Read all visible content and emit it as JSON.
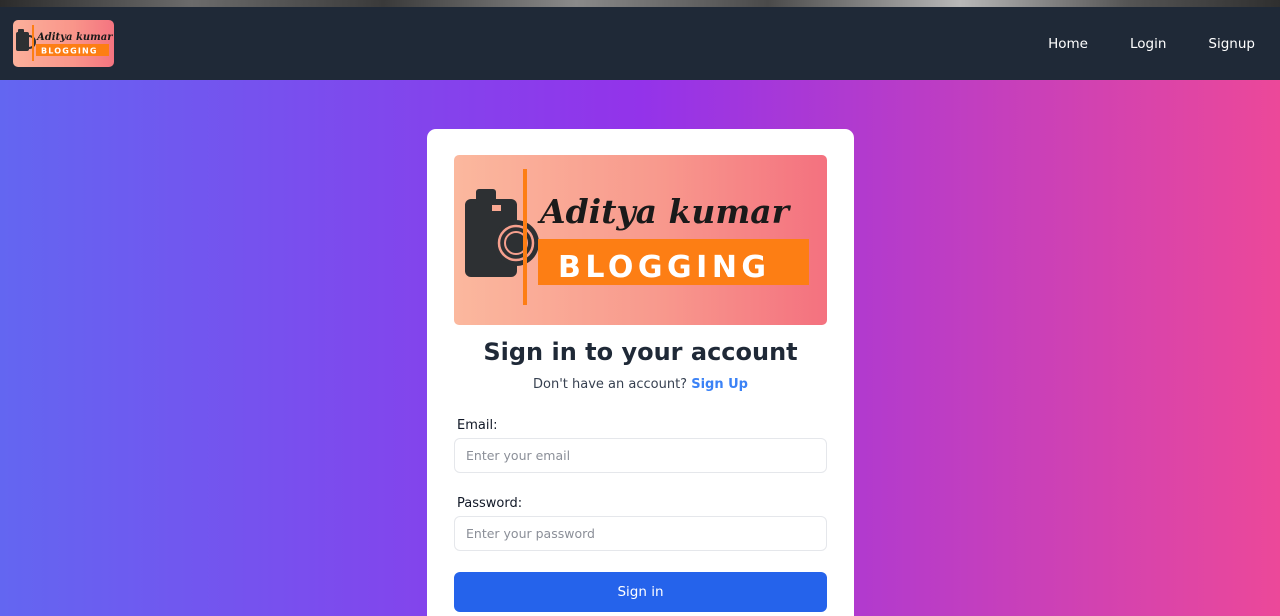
{
  "logo": {
    "line1": "Aditya kumar",
    "line2": "BLOGGING"
  },
  "nav": {
    "items": [
      {
        "label": "Home"
      },
      {
        "label": "Login"
      },
      {
        "label": "Signup"
      }
    ]
  },
  "login": {
    "title": "Sign in to your account",
    "prompt": "Don't have an account?",
    "signup_link": "Sign Up",
    "email_label": "Email:",
    "email_placeholder": "Enter your email",
    "password_label": "Password:",
    "password_placeholder": "Enter your password",
    "submit": "Sign in"
  },
  "colors": {
    "navbar": "#1f2937",
    "gradient_start": "#6366f1",
    "gradient_mid": "#9333ea",
    "gradient_end": "#ec4899",
    "primary_button": "#2563eb",
    "link": "#3b82f6",
    "logo_orange": "#fd7e14"
  }
}
